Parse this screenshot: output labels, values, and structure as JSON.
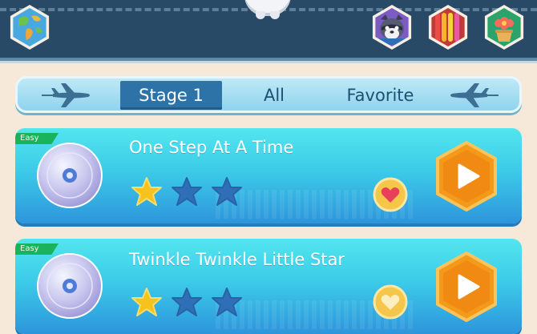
{
  "header": {
    "icons": [
      "world-map-icon",
      "raccoon-avatar-icon",
      "color-stripes-icon",
      "flower-pot-icon"
    ]
  },
  "tabs": [
    {
      "label": "Stage 1",
      "active": true
    },
    {
      "label": "All",
      "active": false
    },
    {
      "label": "Favorite",
      "active": false
    }
  ],
  "songs": [
    {
      "difficulty": "Easy",
      "title": "One Step At A Time",
      "stars": 1,
      "max_stars": 3,
      "favorited": true
    },
    {
      "difficulty": "Easy",
      "title": "Twinkle Twinkle Little Star",
      "stars": 1,
      "max_stars": 3,
      "favorited": false
    }
  ],
  "colors": {
    "topbar": "#284a66",
    "background": "#f6e9d9",
    "tab_active": "#2e73a8",
    "card": "#3ccbe8",
    "star_filled": "#f6c21e",
    "star_empty": "#2f6fb8",
    "play_button": "#f39a1b"
  }
}
